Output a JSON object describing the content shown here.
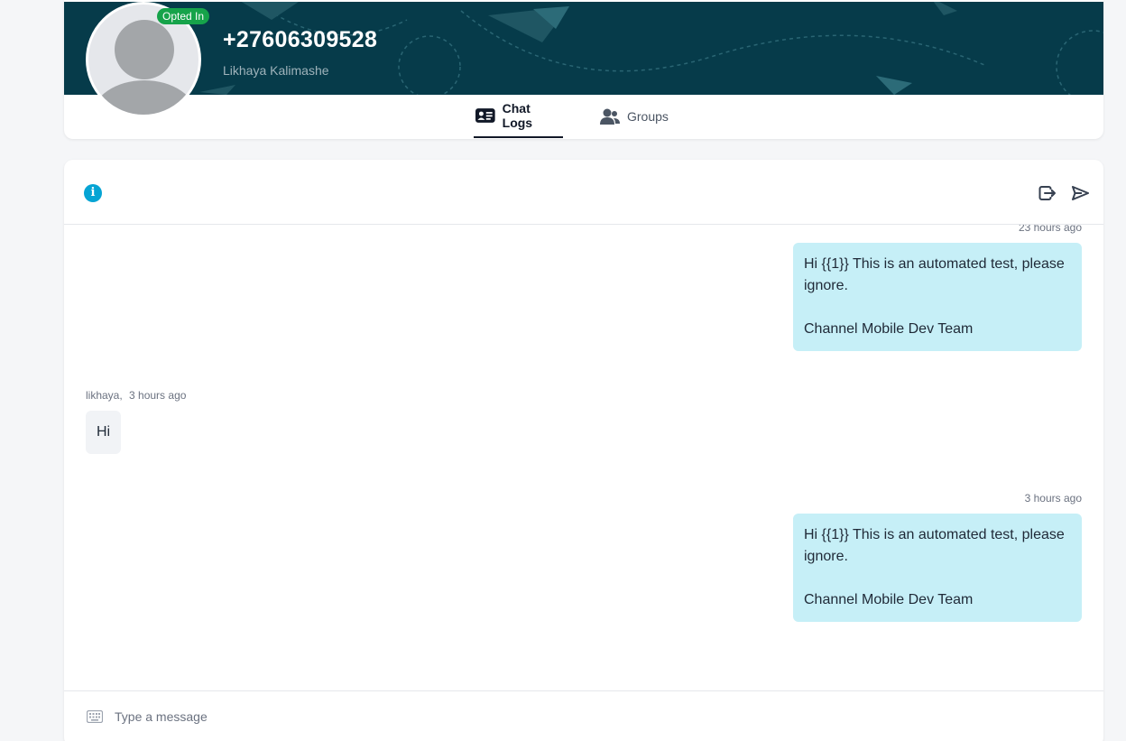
{
  "contact": {
    "phone": "+27606309528",
    "name": "Likhaya Kalimashe",
    "status_badge": "Opted In"
  },
  "tabs": [
    {
      "label": "Chat Logs",
      "icon": "address-card-icon",
      "active": true
    },
    {
      "label": "Groups",
      "icon": "users-icon",
      "active": false
    }
  ],
  "colors": {
    "banner": "#063b4a",
    "badge": "#16a34a",
    "outgoing_bubble": "#c6eff7",
    "incoming_bubble": "#f1f3f6",
    "info_icon": "#06a4d4"
  },
  "messages": [
    {
      "direction": "outgoing",
      "time": "23 hours ago",
      "text": "Hi {{1}} This is an automated test, please ignore.\n\nChannel Mobile Dev Team"
    },
    {
      "direction": "incoming",
      "sender": "likhaya,",
      "time": "3 hours ago",
      "text": "Hi"
    },
    {
      "direction": "outgoing",
      "time": "3 hours ago",
      "text": "Hi {{1}} This is an automated test, please ignore.\n\nChannel Mobile Dev Team"
    }
  ],
  "composer": {
    "placeholder": "Type a message"
  }
}
